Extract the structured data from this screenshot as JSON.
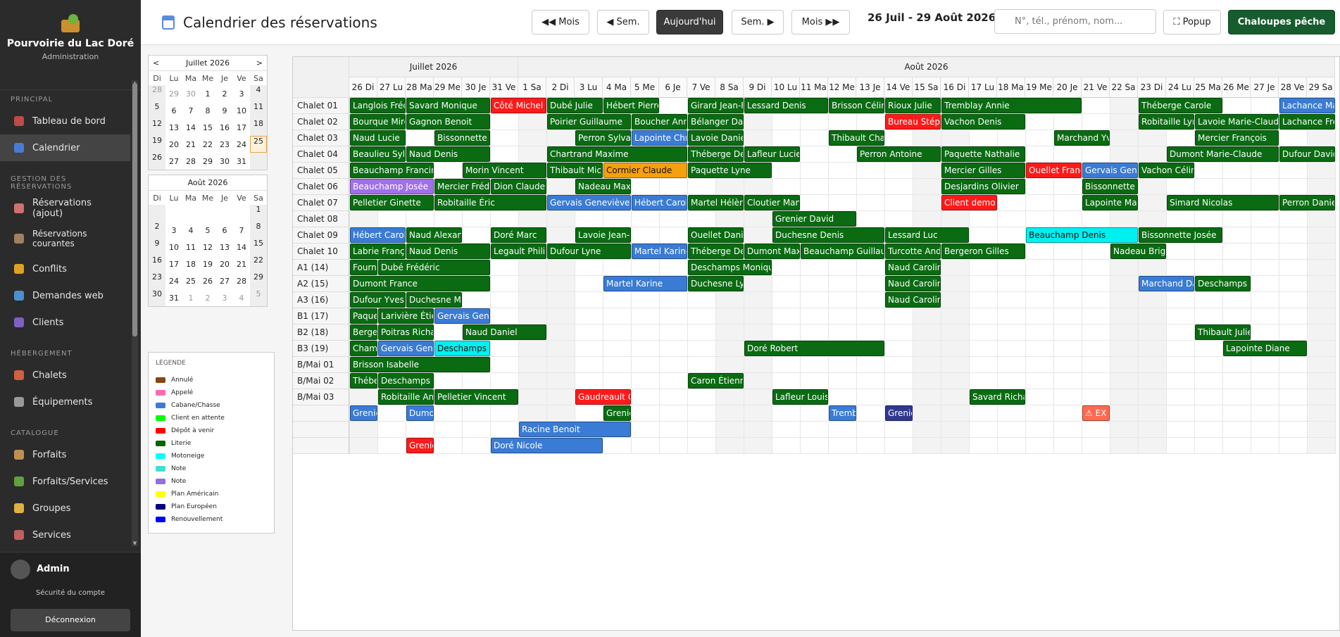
{
  "app": {
    "name": "Pourvoirie du Lac Doré",
    "subtitle": "Administration"
  },
  "nav": [
    {
      "section": "Principal",
      "items": [
        {
          "label": "Tableau de bord",
          "icon": "dashboard-icon",
          "color": "#c04a4a"
        },
        {
          "label": "Calendrier",
          "icon": "calendar-icon",
          "color": "#4a7bd4",
          "active": true
        }
      ]
    },
    {
      "section": "Gestion des réservations",
      "items": [
        {
          "label": "Réservations (ajout)",
          "icon": "document-icon",
          "color": "#d07070"
        },
        {
          "label": "Réservations courantes",
          "icon": "clipboard-icon",
          "color": "#a08060",
          "two": true
        },
        {
          "label": "Conflits",
          "icon": "warning-icon",
          "color": "#e0a020"
        },
        {
          "label": "Demandes web",
          "icon": "globe-icon",
          "color": "#4a90d0"
        },
        {
          "label": "Clients",
          "icon": "users-icon",
          "color": "#8060c0"
        }
      ]
    },
    {
      "section": "Hébergement",
      "items": [
        {
          "label": "Chalets",
          "icon": "house-icon",
          "color": "#d06040"
        },
        {
          "label": "Équipements",
          "icon": "wrench-icon",
          "color": "#999999"
        }
      ]
    },
    {
      "section": "Catalogue",
      "items": [
        {
          "label": "Forfaits",
          "icon": "package-icon",
          "color": "#c09050"
        },
        {
          "label": "Forfaits/Services",
          "icon": "puzzle-icon",
          "color": "#60a040"
        },
        {
          "label": "Groupes",
          "icon": "folder-icon",
          "color": "#e0b040"
        },
        {
          "label": "Services",
          "icon": "tag-icon",
          "color": "#c06060"
        }
      ]
    }
  ],
  "user": {
    "name": "Admin",
    "security": "Sécurité du compte",
    "logout": "Déconnexion"
  },
  "header": {
    "title": "Calendrier des réservations",
    "range": "26 Juil - 29 Août 2026",
    "search_placeholder": "N°, tél., prénom, nom...",
    "buttons": {
      "prev_month": "◀◀ Mois",
      "prev_week": "◀ Sem.",
      "today": "Aujourd'hui",
      "next_week": "Sem. ▶",
      "next_month": "Mois ▶▶",
      "popup": "⛶ Popup",
      "chaloupes": "Chaloupes pêche"
    }
  },
  "minical": {
    "dow": [
      "Di",
      "Lu",
      "Ma",
      "Me",
      "Je",
      "Ve",
      "Sa"
    ],
    "months": [
      {
        "title": "Juillet 2026",
        "prev": "<",
        "next": ">",
        "weeks": [
          [
            "28",
            "29",
            "30",
            "1",
            "2",
            "3",
            "4"
          ],
          [
            "5",
            "6",
            "7",
            "8",
            "9",
            "10",
            "11"
          ],
          [
            "12",
            "13",
            "14",
            "15",
            "16",
            "17",
            "18"
          ],
          [
            "19",
            "20",
            "21",
            "22",
            "23",
            "24",
            "25"
          ],
          [
            "26",
            "27",
            "28",
            "29",
            "30",
            "31",
            ""
          ]
        ],
        "other": [
          [
            0,
            0
          ],
          [
            0,
            1
          ],
          [
            0,
            2
          ]
        ],
        "today": [
          3,
          6
        ]
      },
      {
        "title": "Août 2026",
        "weeks": [
          [
            "",
            "",
            "",
            "",
            "",
            "",
            "1"
          ],
          [
            "2",
            "3",
            "4",
            "5",
            "6",
            "7",
            "8"
          ],
          [
            "9",
            "10",
            "11",
            "12",
            "13",
            "14",
            "15"
          ],
          [
            "16",
            "17",
            "18",
            "19",
            "20",
            "21",
            "22"
          ],
          [
            "23",
            "24",
            "25",
            "26",
            "27",
            "28",
            "29"
          ],
          [
            "30",
            "31",
            "1",
            "2",
            "3",
            "4",
            "5"
          ]
        ],
        "other": [
          [
            5,
            2
          ],
          [
            5,
            3
          ],
          [
            5,
            4
          ],
          [
            5,
            5
          ],
          [
            5,
            6
          ]
        ]
      }
    ]
  },
  "legend": {
    "title": "LÉGENDE",
    "items": [
      {
        "label": "Annulé",
        "color": "#8b4513"
      },
      {
        "label": "Appelé",
        "color": "#ff69b4"
      },
      {
        "label": "Cabane/Chasse",
        "color": "#3a7bd5"
      },
      {
        "label": "Client en attente",
        "color": "#00ff00"
      },
      {
        "label": "Dépôt à venir",
        "color": "#ff0000"
      },
      {
        "label": "Literie",
        "color": "#006400"
      },
      {
        "label": "Motoneige",
        "color": "#00ffff"
      },
      {
        "label": "Note",
        "color": "#40e0d0"
      },
      {
        "label": "Note",
        "color": "#9370db"
      },
      {
        "label": "Plan Américain",
        "color": "#ffff00"
      },
      {
        "label": "Plan Européen",
        "color": "#000080"
      },
      {
        "label": "Renouvellement",
        "color": "#0000ff"
      }
    ]
  },
  "calendar": {
    "months": [
      {
        "label": "Juillet 2026",
        "days": 6
      },
      {
        "label": "Août 2026",
        "days": 29
      }
    ],
    "days": [
      "26 Di",
      "27 Lu",
      "28 Ma",
      "29 Me",
      "30 Je",
      "31 Ve",
      "1 Sa",
      "2 Di",
      "3 Lu",
      "4 Ma",
      "5 Me",
      "6 Je",
      "7 Ve",
      "8 Sa",
      "9 Di",
      "10 Lu",
      "11 Ma",
      "12 Me",
      "13 Je",
      "14 Ve",
      "15 Sa",
      "16 Di",
      "17 Lu",
      "18 Ma",
      "19 Me",
      "20 Je",
      "21 Ve",
      "22 Sa",
      "23 Di",
      "24 Lu",
      "25 Ma",
      "26 Me",
      "27 Je",
      "28 Ve",
      "29 Sa"
    ],
    "weekend_days": [
      0,
      6,
      7,
      13,
      14,
      20,
      21,
      27,
      28,
      34
    ],
    "rows": [
      "Chalet 01",
      "Chalet 02",
      "Chalet 03",
      "Chalet 04",
      "Chalet 05",
      "Chalet 06",
      "Chalet 07",
      "Chalet 08",
      "Chalet 09",
      "Chalet 10",
      "A1 (14)",
      "A2 (15)",
      "A3 (16)",
      "B1 (17)",
      "B2 (18)",
      "B3 (19)",
      "B/Mai 01",
      "B/Mai 02",
      "B/Mai 03",
      "",
      "",
      ""
    ],
    "colors": {
      "g": "#0a6b12",
      "b": "#3a7bd5",
      "r": "#ff1a1a",
      "o": "#f5a00f",
      "p": "#a070e8",
      "c": "#00f0f0",
      "n": "#303890",
      "s": "#ff6a50"
    },
    "bookings": [
      [
        0,
        0,
        2,
        "g",
        "Langlois Frédéric"
      ],
      [
        0,
        2,
        3,
        "g",
        "Savard Monique"
      ],
      [
        0,
        5,
        2,
        "r",
        "Côté Michel"
      ],
      [
        0,
        7,
        2,
        "g",
        "Dubé Julie"
      ],
      [
        0,
        9,
        2,
        "g",
        "Hébert Pierre"
      ],
      [
        0,
        12,
        2,
        "g",
        "Girard Jean-François"
      ],
      [
        0,
        14,
        3,
        "g",
        "Lessard Denis"
      ],
      [
        0,
        17,
        2,
        "g",
        "Brisson Céline"
      ],
      [
        0,
        19,
        2,
        "g",
        "Rioux Julie"
      ],
      [
        0,
        21,
        5,
        "g",
        "Tremblay Annie"
      ],
      [
        0,
        28,
        3,
        "g",
        "Théberge Carole"
      ],
      [
        0,
        33,
        2,
        "b",
        "Lachance Marie"
      ],
      [
        1,
        0,
        2,
        "g",
        "Bourque Mireille"
      ],
      [
        1,
        2,
        3,
        "g",
        "Gagnon Benoit"
      ],
      [
        1,
        7,
        3,
        "g",
        "Poirier Guillaume"
      ],
      [
        1,
        10,
        2,
        "g",
        "Boucher Annie"
      ],
      [
        1,
        12,
        2,
        "g",
        "Bélanger Daniel"
      ],
      [
        1,
        19,
        2,
        "r",
        "Bureau Stéphane"
      ],
      [
        1,
        21,
        3,
        "g",
        "Vachon Denis"
      ],
      [
        1,
        28,
        2,
        "g",
        "Robitaille Lynda"
      ],
      [
        1,
        30,
        3,
        "g",
        "Lavoie Marie-Claude"
      ],
      [
        1,
        33,
        2,
        "g",
        "Lachance Frédéric"
      ],
      [
        2,
        0,
        2,
        "g",
        "Naud Lucie"
      ],
      [
        2,
        3,
        2,
        "g",
        "Bissonnette Denis"
      ],
      [
        2,
        8,
        2,
        "g",
        "Perron Sylvain"
      ],
      [
        2,
        10,
        2,
        "b",
        "Lapointe Christian"
      ],
      [
        2,
        12,
        2,
        "g",
        "Lavoie Daniel"
      ],
      [
        2,
        17,
        2,
        "g",
        "Thibault Chantal"
      ],
      [
        2,
        25,
        2,
        "g",
        "Marchand Yves"
      ],
      [
        2,
        30,
        3,
        "g",
        "Mercier François"
      ],
      [
        3,
        0,
        2,
        "g",
        "Beaulieu Sylvain"
      ],
      [
        3,
        2,
        3,
        "g",
        "Naud Denis"
      ],
      [
        3,
        7,
        5,
        "g",
        "Chartrand Maxime"
      ],
      [
        3,
        12,
        2,
        "g",
        "Théberge Denis"
      ],
      [
        3,
        14,
        2,
        "g",
        "Lafleur Lucie"
      ],
      [
        3,
        18,
        3,
        "g",
        "Perron Antoine"
      ],
      [
        3,
        21,
        3,
        "g",
        "Paquette Nathalie"
      ],
      [
        3,
        29,
        4,
        "g",
        "Dumont Marie-Claude"
      ],
      [
        3,
        33,
        2,
        "g",
        "Dufour David"
      ],
      [
        4,
        0,
        3,
        "g",
        "Beauchamp Francine"
      ],
      [
        4,
        4,
        3,
        "g",
        "Morin Vincent"
      ],
      [
        4,
        7,
        2,
        "g",
        "Thibault Michel"
      ],
      [
        4,
        9,
        3,
        "o",
        "Cormier Claude"
      ],
      [
        4,
        12,
        3,
        "g",
        "Paquette Lyne"
      ],
      [
        4,
        21,
        3,
        "g",
        "Mercier Gilles"
      ],
      [
        4,
        24,
        2,
        "r",
        "Ouellet François"
      ],
      [
        4,
        26,
        2,
        "b",
        "Gervais Geneviève"
      ],
      [
        4,
        28,
        2,
        "g",
        "Vachon Céline"
      ],
      [
        5,
        0,
        3,
        "p",
        "Beauchamp Josée"
      ],
      [
        5,
        3,
        2,
        "g",
        "Mercier Frédéric"
      ],
      [
        5,
        5,
        2,
        "g",
        "Dion Claude"
      ],
      [
        5,
        8,
        2,
        "g",
        "Nadeau Maxime"
      ],
      [
        5,
        21,
        3,
        "g",
        "Desjardins Olivier"
      ],
      [
        5,
        26,
        2,
        "g",
        "Bissonnette Véronique"
      ],
      [
        6,
        0,
        3,
        "g",
        "Pelletier Ginette"
      ],
      [
        6,
        3,
        4,
        "g",
        "Robitaille Éric"
      ],
      [
        6,
        7,
        3,
        "b",
        "Gervais Geneviève"
      ],
      [
        6,
        10,
        2,
        "b",
        "Hébert Carole"
      ],
      [
        6,
        12,
        2,
        "g",
        "Martel Hélène"
      ],
      [
        6,
        14,
        2,
        "g",
        "Cloutier Manon"
      ],
      [
        6,
        21,
        2,
        "r",
        "Client demo ..."
      ],
      [
        6,
        26,
        2,
        "g",
        "Lapointe Marc"
      ],
      [
        6,
        29,
        4,
        "g",
        "Simard Nicolas"
      ],
      [
        6,
        33,
        2,
        "g",
        "Perron Daniel"
      ],
      [
        7,
        15,
        3,
        "g",
        "Grenier David"
      ],
      [
        8,
        0,
        2,
        "b",
        "Hébert Carole"
      ],
      [
        8,
        2,
        2,
        "g",
        "Naud Alexandre"
      ],
      [
        8,
        5,
        2,
        "g",
        "Doré Marc"
      ],
      [
        8,
        8,
        2,
        "g",
        "Lavoie Jean-François"
      ],
      [
        8,
        12,
        2,
        "g",
        "Ouellet Daniel"
      ],
      [
        8,
        15,
        4,
        "g",
        "Duchesne Denis"
      ],
      [
        8,
        19,
        3,
        "g",
        "Lessard Luc"
      ],
      [
        8,
        24,
        4,
        "c",
        "Beauchamp Denis"
      ],
      [
        8,
        28,
        3,
        "g",
        "Bissonnette Josée"
      ],
      [
        9,
        0,
        2,
        "g",
        "Labrie François"
      ],
      [
        9,
        2,
        3,
        "g",
        "Naud Denis"
      ],
      [
        9,
        5,
        2,
        "g",
        "Legault Philippe"
      ],
      [
        9,
        7,
        3,
        "g",
        "Dufour Lyne"
      ],
      [
        9,
        10,
        2,
        "b",
        "Martel Karine"
      ],
      [
        9,
        12,
        2,
        "g",
        "Théberge Denis"
      ],
      [
        9,
        14,
        2,
        "g",
        "Dumont Maxime"
      ],
      [
        9,
        16,
        3,
        "g",
        "Beauchamp Guillaume"
      ],
      [
        9,
        19,
        2,
        "g",
        "Turcotte André"
      ],
      [
        9,
        21,
        3,
        "g",
        "Bergeron Gilles"
      ],
      [
        9,
        27,
        2,
        "g",
        "Nadeau Brigitte"
      ],
      [
        10,
        0,
        1,
        "g",
        "Fournier Luc"
      ],
      [
        10,
        1,
        4,
        "g",
        "Dubé Frédéric"
      ],
      [
        10,
        12,
        3,
        "g",
        "Deschamps Monique"
      ],
      [
        10,
        19,
        2,
        "g",
        "Naud Caroline"
      ],
      [
        11,
        0,
        5,
        "g",
        "Dumont France"
      ],
      [
        11,
        9,
        3,
        "b",
        "Martel Karine"
      ],
      [
        11,
        12,
        2,
        "g",
        "Duchesne Lyne"
      ],
      [
        11,
        19,
        2,
        "g",
        "Naud Caroline"
      ],
      [
        11,
        28,
        2,
        "b",
        "Marchand Daniel"
      ],
      [
        11,
        30,
        2,
        "g",
        "Deschamps Éric"
      ],
      [
        12,
        0,
        2,
        "g",
        "Dufour Yves"
      ],
      [
        12,
        2,
        2,
        "g",
        "Duchesne Michel"
      ],
      [
        12,
        19,
        2,
        "g",
        "Naud Caroline"
      ],
      [
        13,
        0,
        1,
        "g",
        "Paquette Luc"
      ],
      [
        13,
        1,
        2,
        "g",
        "Larivière Étienne"
      ],
      [
        13,
        3,
        2,
        "b",
        "Gervais Geneviève"
      ],
      [
        14,
        0,
        1,
        "g",
        "Bergeron Luc"
      ],
      [
        14,
        1,
        2,
        "g",
        "Poitras Richard"
      ],
      [
        14,
        4,
        3,
        "g",
        "Naud Daniel"
      ],
      [
        14,
        30,
        2,
        "g",
        "Thibault Julie"
      ],
      [
        15,
        0,
        1,
        "g",
        "Champagne Luc"
      ],
      [
        15,
        1,
        2,
        "b",
        "Gervais Geneviève"
      ],
      [
        15,
        3,
        2,
        "c",
        "Deschamps Claude"
      ],
      [
        15,
        14,
        5,
        "g",
        "Doré Robert"
      ],
      [
        15,
        31,
        3,
        "g",
        "Lapointe Diane"
      ],
      [
        16,
        0,
        5,
        "g",
        "Brisson Isabelle"
      ],
      [
        17,
        0,
        1,
        "g",
        "Théberge Luc"
      ],
      [
        17,
        1,
        2,
        "g",
        "Deschamps Yves"
      ],
      [
        17,
        12,
        2,
        "g",
        "Caron Étienne"
      ],
      [
        18,
        1,
        2,
        "g",
        "Robitaille Antoine"
      ],
      [
        18,
        3,
        3,
        "g",
        "Pelletier Vincent"
      ],
      [
        18,
        8,
        2,
        "r",
        "Gaudreault Guy"
      ],
      [
        18,
        15,
        2,
        "g",
        "Lafleur Louise"
      ],
      [
        18,
        22,
        2,
        "g",
        "Savard Richard"
      ],
      [
        19,
        0,
        1,
        "b",
        "Grenier"
      ],
      [
        19,
        2,
        1,
        "b",
        "Dumont"
      ],
      [
        19,
        9,
        1,
        "g",
        "Grenier"
      ],
      [
        19,
        17,
        1,
        "b",
        "Tremblay"
      ],
      [
        19,
        19,
        1,
        "n",
        "Grenier"
      ],
      [
        19,
        26,
        1,
        "s",
        "⚠ EX"
      ],
      [
        20,
        6,
        4,
        "b",
        "Racine Benoit"
      ],
      [
        21,
        2,
        1,
        "r",
        "Grenier"
      ],
      [
        21,
        5,
        4,
        "b",
        "Doré Nicole"
      ]
    ]
  }
}
